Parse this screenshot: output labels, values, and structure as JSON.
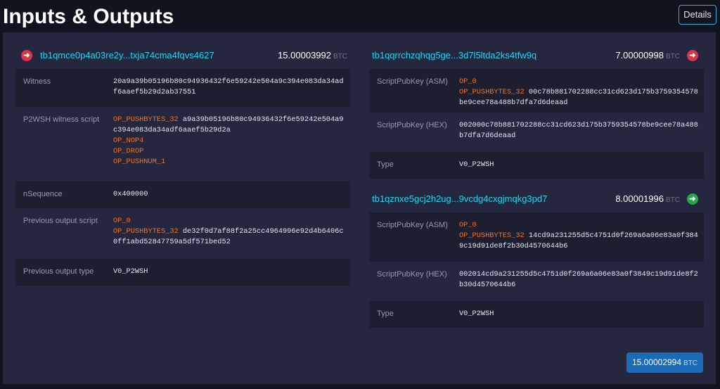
{
  "page": {
    "title": "Inputs & Outputs",
    "details_label": "Details"
  },
  "btc_unit": "BTC",
  "inputs": [
    {
      "address": "tb1qmce0p4a03re2y...txja74cma4fqvs4627",
      "amount": "15.00003992",
      "rows": {
        "witness_label": "Witness",
        "witness_value": "20a9a39b05196b80c94936432f6e59242e504a9c394e083da34adf6aaef5b29d2ab37551",
        "p2wsh_label": "P2WSH witness script",
        "p2wsh_op1": "OP_PUSHBYTES_32",
        "p2wsh_data": "a9a39b05196b80c94936432f6e59242e504a9c394e083da34adf6aaef5b29d2a",
        "p2wsh_op2": "OP_NOP4",
        "p2wsh_op3": "OP_DROP",
        "p2wsh_op4": "OP_PUSHNUM_1",
        "nsequence_label": "nSequence",
        "nsequence_value": "0x400000",
        "prevscript_label": "Previous output script",
        "prevscript_op1": "OP_0",
        "prevscript_op2": "OP_PUSHBYTES_32",
        "prevscript_data": "de32f0d7af88f2a25cc4964996e92d4b6406c0ff1abd52847759a5df571bed52",
        "prevtype_label": "Previous output type",
        "prevtype_value": "V0_P2WSH"
      }
    }
  ],
  "outputs": [
    {
      "address": "tb1qqrrchzqhqg5ge...3d7l5ltda2ks4tfw9q",
      "amount": "7.00000998",
      "asm_label": "ScriptPubKey (ASM)",
      "asm_op1": "OP_0",
      "asm_op2": "OP_PUSHBYTES_32",
      "asm_data": "00c78b881702288cc31cd623d175b3759354578be9cee78a488b7dfa7d6deaad",
      "hex_label": "ScriptPubKey (HEX)",
      "hex_value": "002000c78b881702288cc31cd623d175b3759354578be9cee78a488b7dfa7d6deaad",
      "type_label": "Type",
      "type_value": "V0_P2WSH"
    },
    {
      "address": "tb1qznxe5gcj2h2ug...9vcdg4cxgjmqkg3pd7",
      "amount": "8.00001996",
      "asm_label": "ScriptPubKey (ASM)",
      "asm_op1": "OP_0",
      "asm_op2": "OP_PUSHBYTES_32",
      "asm_data": "14cd9a231255d5c4751d0f269a6a06e83a0f3849c19d91de8f2b30d4570644b6",
      "hex_label": "ScriptPubKey (HEX)",
      "hex_value": "002014cd9a231255d5c4751d0f269a6a06e83a0f3849c19d91de8f2b30d4570644b6",
      "type_label": "Type",
      "type_value": "V0_P2WSH"
    }
  ],
  "total": {
    "amount": "15.00002994"
  },
  "icons": {
    "input_icon": "arrow-right-circle-icon",
    "spent_output_icon": "arrow-right-circle-icon",
    "unspent_output_icon": "arrow-right-circle-icon"
  },
  "colors": {
    "accent_cyan": "#1bd8f4",
    "opcode_orange": "#f4731d",
    "spent_red": "#dc3545",
    "unspent_green": "#28a745",
    "total_blue": "#1a6bb8"
  }
}
